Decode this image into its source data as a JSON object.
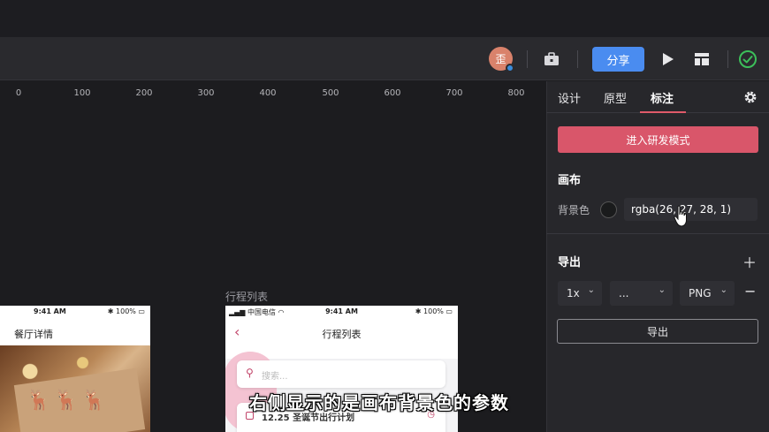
{
  "toolbar": {
    "avatar_text": "歪",
    "share_label": "分享"
  },
  "ruler": {
    "ticks": [
      "0",
      "100",
      "200",
      "300",
      "400",
      "500",
      "600",
      "700",
      "800"
    ]
  },
  "canvas": {
    "artboard_label": "行程列表",
    "phone1": {
      "time": "9:41 AM",
      "battery": "100%",
      "title": "餐厅详情"
    },
    "phone2": {
      "carrier": "中国电信",
      "time": "9:41 AM",
      "battery": "100%",
      "title": "行程列表",
      "search_placeholder": "搜索...",
      "item_text": "12.25 圣诞节出行计划"
    }
  },
  "panel": {
    "tabs": [
      "设计",
      "原型",
      "标注"
    ],
    "active_tab": "标注",
    "dev_mode_label": "进入研发模式",
    "canvas_section": "画布",
    "bg_color_label": "背景色",
    "bg_color_value": "rgba(26, 27, 28, 1)",
    "export_section": "导出",
    "scale_value": "1x",
    "suffix_value": "...",
    "format_value": "PNG",
    "export_button": "导出"
  },
  "subtitle": "右侧显示的是画布背景色的参数",
  "colors": {
    "accent_blue": "#4a8cf0",
    "accent_red": "#d9566a",
    "status_green": "#3cbf5a",
    "background": "#1a1b1c"
  }
}
